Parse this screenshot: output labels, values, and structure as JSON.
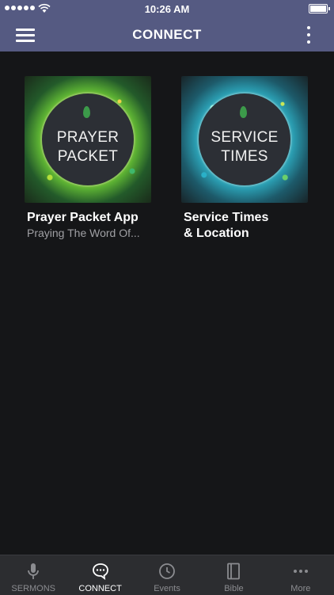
{
  "status_bar": {
    "time": "10:26 AM"
  },
  "header": {
    "title": "CONNECT"
  },
  "tiles": [
    {
      "art_lines": [
        "PRAYER",
        "PACKET"
      ],
      "title": "Prayer Packet App",
      "subtitle": "Praying The Word Of..."
    },
    {
      "art_lines": [
        "SERVICE",
        "TIMES"
      ],
      "title_lines": [
        "Service Times",
        "& Location"
      ]
    }
  ],
  "tabs": [
    {
      "label": "SERMONS",
      "icon": "microphone-icon",
      "active": false
    },
    {
      "label": "CONNECT",
      "icon": "chat-bubble-icon",
      "active": true
    },
    {
      "label": "Events",
      "icon": "clock-icon",
      "active": false
    },
    {
      "label": "Bible",
      "icon": "book-icon",
      "active": false
    },
    {
      "label": "More",
      "icon": "more-dots-icon",
      "active": false
    }
  ],
  "colors": {
    "header_bg": "#555a82",
    "page_bg": "#151618",
    "tabbar_bg": "#2c2d30"
  }
}
